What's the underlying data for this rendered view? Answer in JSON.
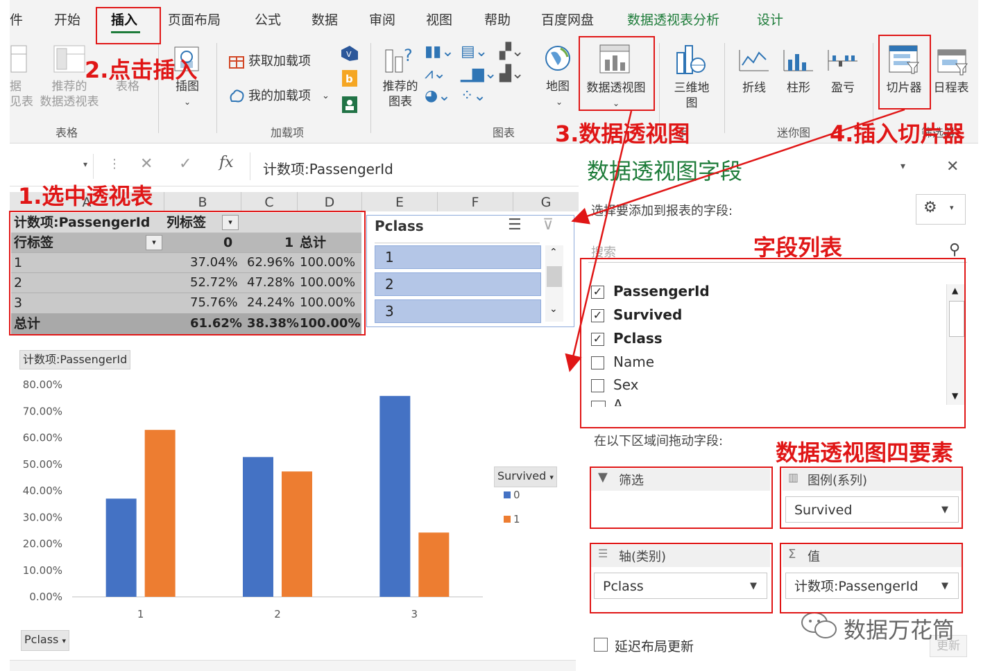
{
  "ribbon": {
    "tabs": [
      "件",
      "开始",
      "插入",
      "页面布局",
      "公式",
      "数据",
      "审阅",
      "视图",
      "帮助",
      "百度网盘",
      "数据透视表分析",
      "设计"
    ],
    "buttons": {
      "pivot_table_partial": "据\n见表",
      "recommended_pivot": "推荐的\n数据透视表",
      "table": "表格",
      "illustrations": "插图",
      "get_addins": "获取加载项",
      "my_addins": "我的加载项",
      "recommended_charts": "推荐的\n图表",
      "maps": "地图",
      "pivot_chart": "数据透视图",
      "map_3d": "三维地\n图",
      "sparkline_line": "折线",
      "sparkline_column": "柱形",
      "sparkline_winloss": "盈亏",
      "slicer": "切片器",
      "timeline": "日程表"
    },
    "groups": {
      "tables": "表格",
      "addins": "加载项",
      "charts": "图表",
      "tours_partial": "示",
      "sparklines": "迷你图",
      "filters_partial": "筛选器"
    }
  },
  "annotations": {
    "step1": "1.选中透视表",
    "step2": "2.点击插入",
    "step3": "3.数据透视图",
    "step4": "4.插入切片器",
    "field_list": "字段列表",
    "four_elements": "数据透视图四要素"
  },
  "formula_bar": {
    "formula": "计数项:PassengerId",
    "fx": "fx"
  },
  "grid": {
    "columns": [
      "A",
      "B",
      "C",
      "D",
      "E",
      "F",
      "G"
    ],
    "pivot": {
      "header_left": "计数项:PassengerId",
      "col_label": "列标签",
      "row_label": "行标签",
      "col0": "0",
      "col1": "1",
      "total_hdr": "总计",
      "rows": [
        {
          "label": "1",
          "v0": "37.04%",
          "v1": "62.96%",
          "t": "100.00%"
        },
        {
          "label": "2",
          "v0": "52.72%",
          "v1": "47.28%",
          "t": "100.00%"
        },
        {
          "label": "3",
          "v0": "75.76%",
          "v1": "24.24%",
          "t": "100.00%"
        }
      ],
      "grand": {
        "label": "总计",
        "v0": "61.62%",
        "v1": "38.38%",
        "t": "100.00%"
      }
    }
  },
  "slicer": {
    "title": "Pclass",
    "items": [
      "1",
      "2",
      "3"
    ]
  },
  "chart_data": {
    "type": "bar",
    "title": "",
    "field_button": "计数项:PassengerId",
    "categories": [
      "1",
      "2",
      "3"
    ],
    "series": [
      {
        "name": "0",
        "values": [
          37.04,
          52.72,
          75.76
        ],
        "color": "#4472c4"
      },
      {
        "name": "1",
        "values": [
          62.96,
          47.28,
          24.24
        ],
        "color": "#ed7d31"
      }
    ],
    "yticks": [
      "0.00%",
      "10.00%",
      "20.00%",
      "30.00%",
      "40.00%",
      "50.00%",
      "60.00%",
      "70.00%",
      "80.00%"
    ],
    "ylim": [
      0,
      80
    ],
    "legend_title": "Survived",
    "legend_position": "right",
    "axis_button": "Pclass",
    "grid": false
  },
  "panel": {
    "title": "数据透视图字段",
    "choose_text": "选择要添加到报表的字段:",
    "search_placeholder": "搜索",
    "fields": [
      {
        "name": "PassengerId",
        "checked": true
      },
      {
        "name": "Survived",
        "checked": true
      },
      {
        "name": "Pclass",
        "checked": true
      },
      {
        "name": "Name",
        "checked": false
      },
      {
        "name": "Sex",
        "checked": false
      },
      {
        "name": "A",
        "checked": false
      }
    ],
    "drag_text": "在以下区域间拖动字段:",
    "areas": {
      "filter_title": "筛选",
      "legend_title": "图例(系列)",
      "legend_value": "Survived",
      "axis_title": "轴(类别)",
      "axis_value": "Pclass",
      "values_title": "值",
      "values_value": "计数项:PassengerId"
    },
    "defer_label": "延迟布局更新",
    "update_button": "更新",
    "watermark": "数据万花筒"
  },
  "colors": {
    "accent_green": "#1e7c3a",
    "annotation_red": "#e01616",
    "series0": "#4472c4",
    "series1": "#ed7d31"
  }
}
